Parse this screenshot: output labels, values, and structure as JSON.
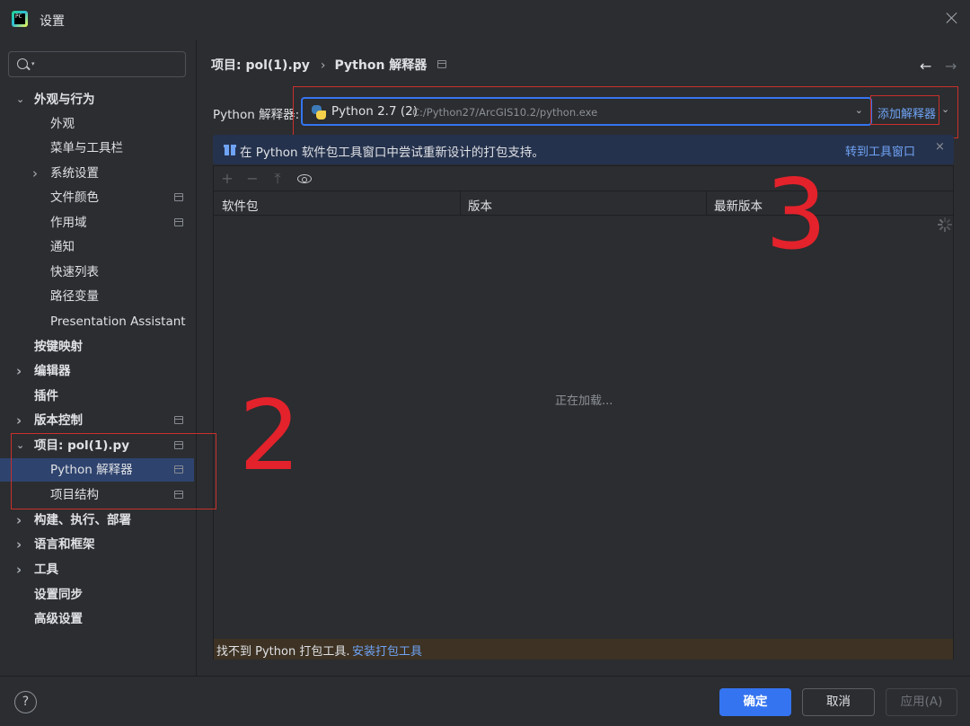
{
  "window": {
    "title": "设置"
  },
  "search": {
    "placeholder": "",
    "value": ""
  },
  "sidebar": {
    "items": [
      {
        "label": "外观与行为",
        "bold": true,
        "expanded": true
      },
      {
        "label": "外观"
      },
      {
        "label": "菜单与工具栏"
      },
      {
        "label": "系统设置",
        "collapsed": true
      },
      {
        "label": "文件颜色",
        "project_icon": true
      },
      {
        "label": "作用域",
        "project_icon": true
      },
      {
        "label": "通知"
      },
      {
        "label": "快速列表"
      },
      {
        "label": "路径变量"
      },
      {
        "label": "Presentation Assistant"
      },
      {
        "label": "按键映射",
        "bold": true
      },
      {
        "label": "编辑器",
        "bold": true,
        "collapsed": true
      },
      {
        "label": "插件",
        "bold": true
      },
      {
        "label": "版本控制",
        "bold": true,
        "collapsed": true,
        "project_icon": true
      },
      {
        "label": "项目: pol(1).py",
        "bold": true,
        "expanded": true,
        "project_icon": true
      },
      {
        "label": "Python 解释器",
        "selected": true,
        "project_icon": true
      },
      {
        "label": "项目结构",
        "project_icon": true
      },
      {
        "label": "构建、执行、部署",
        "bold": true,
        "collapsed": true
      },
      {
        "label": "语言和框架",
        "bold": true,
        "collapsed": true
      },
      {
        "label": "工具",
        "bold": true,
        "collapsed": true
      },
      {
        "label": "设置同步",
        "bold": true
      },
      {
        "label": "高级设置",
        "bold": true
      }
    ]
  },
  "breadcrumb": {
    "project": "项目: pol(1).py",
    "separator": "›",
    "page": "Python 解释器"
  },
  "nav": {
    "back": "←",
    "forward": "→"
  },
  "interpreter": {
    "label": "Python 解释器:",
    "name": "Python 2.7 (2)",
    "path": "C:/Python27/ArcGIS10.2/python.exe",
    "add_label": "添加解释器"
  },
  "banner": {
    "text": "在 Python 软件包工具窗口中尝试重新设计的打包支持。",
    "link": "转到工具窗口",
    "close": "×"
  },
  "packages": {
    "toolbar": {
      "add": "+",
      "remove": "−",
      "upgrade": "⤒"
    },
    "columns": [
      "软件包",
      "版本",
      "最新版本"
    ],
    "loading_text": "正在加载...",
    "footer_text": "找不到 Python 打包工具.",
    "footer_link": "安装打包工具"
  },
  "annotations": {
    "two": "2",
    "three": "3"
  },
  "buttons": {
    "help": "?",
    "ok": "确定",
    "cancel": "取消",
    "apply": "应用(A)"
  },
  "colors": {
    "accent": "#3574f0",
    "link": "#6fa3f5",
    "annotation_red": "#e3222b",
    "selected_row": "#2e436e"
  }
}
